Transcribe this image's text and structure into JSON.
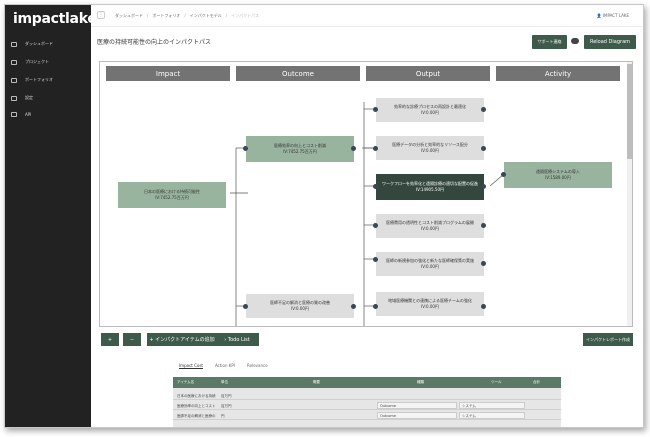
{
  "app": {
    "logo": "impactlake"
  },
  "sidebar": {
    "items": [
      {
        "label": "ダッシュボード"
      },
      {
        "label": "プロジェクト"
      },
      {
        "label": "ポートフォリオ"
      },
      {
        "label": "設定"
      },
      {
        "label": "API"
      }
    ]
  },
  "header": {
    "breadcrumbs": [
      "ダッシュボード",
      "ポートフォリオ",
      "インパクトモデル",
      "インパクトパス"
    ],
    "user": "IMPACT LAKE"
  },
  "page": {
    "title": "医療の持続可能性の向上のインパクトパス",
    "support_button": "サポート連絡",
    "reload_button": "Reload Diagram"
  },
  "diagram": {
    "columns": [
      "Impact",
      "Outcome",
      "Output",
      "Activity"
    ],
    "nodes": [
      {
        "id": "impact1",
        "label": "日本の医療における持続可能性",
        "value": "IV:7452.75百万円"
      },
      {
        "id": "outcome1",
        "label": "医療効率の向上とコスト削減",
        "value": "IV:7452.75百万円"
      },
      {
        "id": "outcome2",
        "label": "医師不足の解消と医療の質の改善",
        "value": "IV:0.00円"
      },
      {
        "id": "output1",
        "label": "効率的な診療プロセスの再設計と最適化",
        "value": "IV:0.00円"
      },
      {
        "id": "output2",
        "label": "医療データの分析と効率的なリソース配分",
        "value": "IV:0.00円"
      },
      {
        "id": "output3",
        "label": "ワークフローを効率化と遠隔診療の適切な配置の促進",
        "value": "IV:14905.50円"
      },
      {
        "id": "output4",
        "label": "医療費用の透明性とコスト削減プログラムの展開",
        "value": "IV:0.00円"
      },
      {
        "id": "output5",
        "label": "医師の新規参加の強化と新たな医師確保策の実施",
        "value": "IV:0.00円"
      },
      {
        "id": "output6",
        "label": "地域医療機関との連携による医療チームの強化",
        "value": "IV:0.00円"
      },
      {
        "id": "activity1",
        "label": "遠隔医療システムの導入",
        "value": "IV:1589.00円"
      }
    ]
  },
  "toolbar": {
    "zoom_in": "+",
    "zoom_out": "−",
    "add_item": "インパクトアイテムの追加",
    "todo": "Todo List",
    "report": "インパクトレポート作成"
  },
  "bottom": {
    "tabs": [
      "Impact Cost",
      "Action KPI",
      "Relevance"
    ],
    "table": {
      "headers": [
        "アイテム名",
        "単位",
        "概要",
        "種類",
        "ツール",
        "合計"
      ],
      "rows": [
        {
          "name": "日本の医療における持続",
          "unit": "百万円",
          "type": "",
          "tool": ""
        },
        {
          "name": "医療効率の向上とコスト",
          "unit": "百万円",
          "type": "Outcome",
          "tool": "システム"
        },
        {
          "name": "医師不足の解消と医療の",
          "unit": "円",
          "type": "Outcome",
          "tool": "システム"
        }
      ]
    }
  },
  "colors": {
    "accent": "#3d5a4a",
    "node_green": "#98b49f",
    "node_dark": "#33473e",
    "header_gray": "#737373"
  }
}
